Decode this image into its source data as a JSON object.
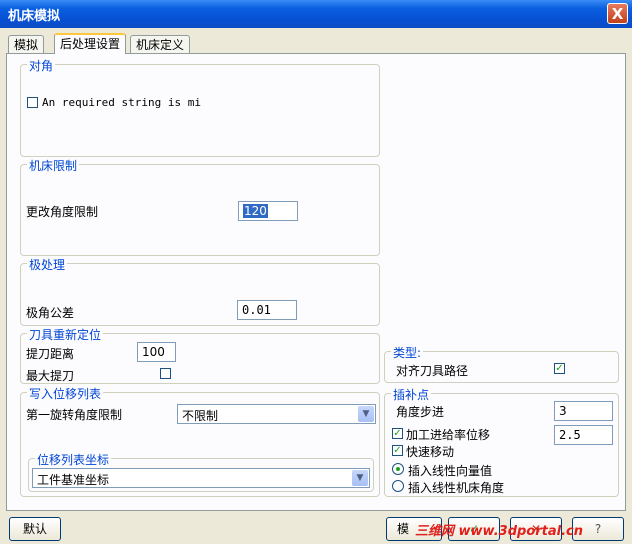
{
  "window": {
    "title": "机床模拟",
    "close_glyph": "X"
  },
  "tabs": [
    {
      "label": "模拟"
    },
    {
      "label": "后处理设置"
    },
    {
      "label": "机床定义"
    }
  ],
  "groups": {
    "align": {
      "title": "对角",
      "checkbox_label": "An required string is mi"
    },
    "machine_limits": {
      "title": "机床限制",
      "angle_change_label": "更改角度限制",
      "angle_change_value": "120"
    },
    "pole": {
      "title": "极处理",
      "pole_tolerance_label": "极角公差",
      "pole_tolerance_value": "0.01"
    },
    "retool": {
      "title": "刀具重新定位",
      "retract_distance_label": "提刀距离",
      "retract_distance_value": "100",
      "max_retract_label": "最大提刀"
    },
    "write_list": {
      "title": "写入位移列表",
      "first_rotation_label": "第一旋转角度限制",
      "first_rotation_value": "不限制"
    },
    "list_coords": {
      "title": "位移列表坐标",
      "value": "工件基准坐标"
    },
    "type": {
      "title": "类型:",
      "align_path_label": "对齐刀具路径"
    },
    "interp": {
      "title": "插补点",
      "angle_step_label": "角度步进",
      "angle_step_value": "3",
      "feed_shift_label": "加工进给率位移",
      "feed_shift_value": "2.5",
      "rapid_label": "快速移动",
      "radio_vector_label": "插入线性向量值",
      "radio_angle_label": "插入线性机床角度"
    }
  },
  "buttons": {
    "default": "默认",
    "simulate": "模",
    "watermark": "三维网 www.3dportal.cn"
  },
  "colors": {
    "title_bar": "#0a5fe0",
    "group_title": "#0046d5",
    "check": "#21a121"
  }
}
